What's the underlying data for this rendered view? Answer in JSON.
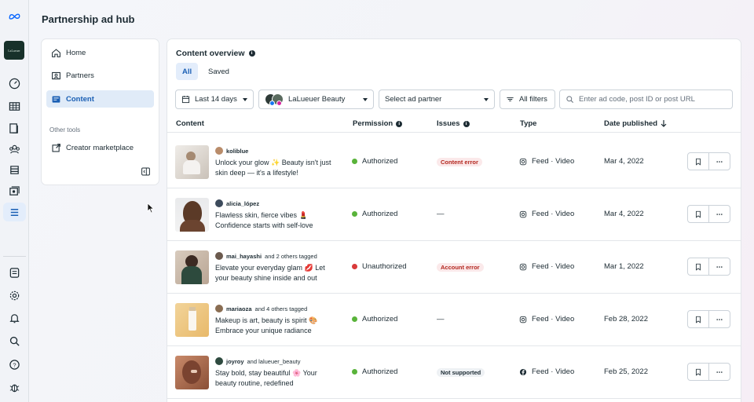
{
  "app": {
    "title": "Partnership ad hub",
    "account_badge": "LaLueuer"
  },
  "nav": {
    "items": [
      {
        "label": "Home",
        "icon": "home-icon"
      },
      {
        "label": "Partners",
        "icon": "partners-icon"
      },
      {
        "label": "Content",
        "icon": "content-icon",
        "active": true
      }
    ],
    "other_tools_label": "Other tools",
    "other_tools": [
      {
        "label": "Creator marketplace",
        "icon": "external-link-icon"
      }
    ]
  },
  "main": {
    "title": "Content overview",
    "tabs": [
      {
        "label": "All",
        "active": true
      },
      {
        "label": "Saved"
      }
    ],
    "filters": {
      "date_range": "Last 14 days",
      "account": "LaLueuer Beauty",
      "ad_partner": "Select ad partner",
      "all_filters": "All filters",
      "search_placeholder": "Enter ad code, post ID or post URL"
    },
    "columns": {
      "content": "Content",
      "permission": "Permission",
      "issues": "Issues",
      "type": "Type",
      "date": "Date published"
    },
    "rows": [
      {
        "author": "koliblue",
        "caption": "Unlock your glow ✨ Beauty isn't just skin deep — it's a lifestyle!",
        "permission": "Authorized",
        "issue": "Content error",
        "type": "Feed · Video",
        "date": "Mar 4, 2022"
      },
      {
        "author": "alicia_lópez",
        "caption": "Flawless skin, fierce vibes 💄 Confidence starts with self-love",
        "permission": "Authorized",
        "issue": "—",
        "type": "Feed · Video",
        "date": "Mar 4, 2022"
      },
      {
        "author": "mai_hayashi",
        "author_suffix": "and 2 others tagged",
        "caption": "Elevate your everyday glam 💋 Let your beauty shine inside and out",
        "permission": "Unauthorized",
        "issue": "Account error",
        "type": "Feed · Video",
        "date": "Mar 1, 2022"
      },
      {
        "author": "mariaoza",
        "author_suffix": "and 4 others tagged",
        "caption": "Makeup is art, beauty is spirit 🎨 Embrace your unique radiance",
        "permission": "Authorized",
        "issue": "—",
        "type": "Feed · Video",
        "date": "Feb 28, 2022"
      },
      {
        "author": "joyroy",
        "author_suffix": "and lalueuer_beauty",
        "caption": "Stay bold, stay beautiful 🌸 Your beauty routine, redefined",
        "permission": "Authorized",
        "issue": "Not supported",
        "type": "Feed · Video",
        "date": "Feb 25, 2022"
      }
    ]
  },
  "colors": {
    "accent": "#1a5fb4",
    "authorized": "#59b33a",
    "unauthorized": "#d93a3a",
    "error_bg": "#fbe9ea",
    "error_text": "#b3261e"
  }
}
